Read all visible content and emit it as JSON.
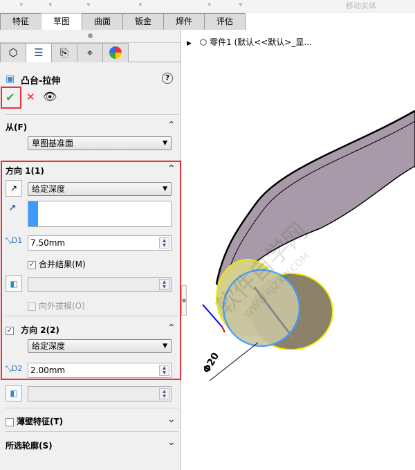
{
  "toolbar": {
    "move_body": "移动实体"
  },
  "tabs": [
    {
      "label": "特征"
    },
    {
      "label": "草图"
    },
    {
      "label": "曲面"
    },
    {
      "label": "钣金"
    },
    {
      "label": "焊件"
    },
    {
      "label": "评估"
    }
  ],
  "tree": {
    "root": "零件1  (默认<<默认>_显..."
  },
  "feature": {
    "title": "凸台-拉伸"
  },
  "from": {
    "label": "从(F)",
    "value": "草图基准面"
  },
  "dir1": {
    "label": "方向 1(1)",
    "end_condition": "给定深度",
    "depth": "7.50mm",
    "merge_label": "合并结果(M)",
    "merge_checked": true,
    "draft_outward": "向外拔模(O)"
  },
  "dir2": {
    "label": "方向 2(2)",
    "checked": true,
    "end_condition": "给定深度",
    "depth": "2.00mm"
  },
  "thin": {
    "label": "薄壁特征(T)"
  },
  "contours": {
    "label": "所选轮廓(S)"
  },
  "viewport": {
    "dimension": "Φ20"
  },
  "watermark": {
    "text": "软件自学网",
    "url": "WWW.RJZXW.COM"
  },
  "colors": {
    "highlight": "#e8303a",
    "accent": "#3d9bff"
  }
}
